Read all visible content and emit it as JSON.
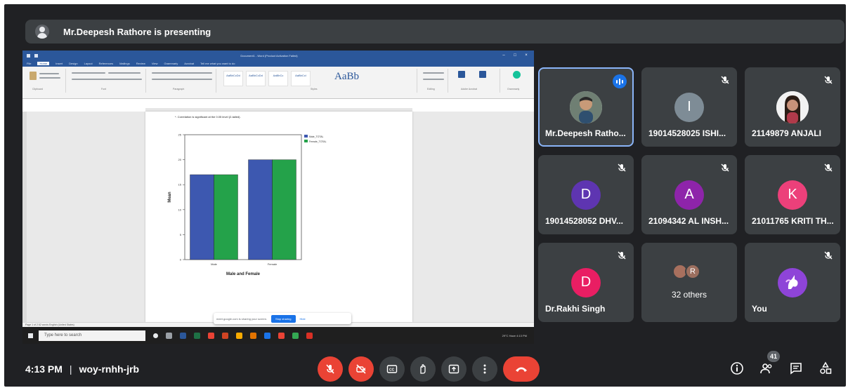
{
  "banner": {
    "text": "Mr.Deepesh Rathore is presenting"
  },
  "screen": {
    "window_title": "Document1 - Word (Product Activation Failed)",
    "menu_tabs": [
      "File",
      "Home",
      "Insert",
      "Design",
      "Layout",
      "References",
      "Mailings",
      "Review",
      "View",
      "Grammarly",
      "Acrobat",
      "Tell me what you want to do"
    ],
    "active_tab": "Home",
    "ribbon_groups": [
      "Clipboard",
      "Font",
      "Paragraph",
      "Styles",
      "Editing",
      "Adobe Acrobat",
      "Grammarly"
    ],
    "style_labels": [
      "AaBbCcDd",
      "AaBbCcDd",
      "AaBbCc",
      "AaBbCcI",
      "AaBb"
    ],
    "correlation_note": "*. Correlation is significant at the 0.05 level (2-tailed).",
    "status_text": "Page 1 of 2   62 words   English (United States)",
    "share_notice": "meet.google.com is sharing your screen.",
    "stop_sharing": "Stop sharing",
    "hide": "Hide",
    "taskbar_search": "Type here to search",
    "tray": "29°C Haze  4:13 PM"
  },
  "chart_data": {
    "type": "bar",
    "categories": [
      "Male",
      "Female"
    ],
    "series": [
      {
        "name": "Male_TOTAL",
        "values": [
          17,
          20
        ]
      },
      {
        "name": "Female_TOTAL",
        "values": [
          17,
          20
        ]
      }
    ],
    "xlabel": "Male and Female",
    "ylabel": "Mean",
    "ylim": [
      0,
      25
    ],
    "yticks": [
      0,
      5,
      10,
      15,
      20,
      25
    ],
    "colors": [
      "#3d58b0",
      "#24a24a"
    ]
  },
  "tiles": [
    {
      "name": "Mr.Deepesh Ratho...",
      "type": "photo",
      "speaking": true
    },
    {
      "name": "19014528025 ISHI...",
      "initial": "I",
      "color": "#7e8c96"
    },
    {
      "name": "21149879 ANJALI",
      "type": "photo"
    },
    {
      "name": "19014528052 DHV...",
      "initial": "D",
      "color": "#5e35b1"
    },
    {
      "name": "21094342 AL INSH...",
      "initial": "A",
      "color": "#8e24aa"
    },
    {
      "name": "21011765 KRITI TH...",
      "initial": "K",
      "color": "#ec407a"
    },
    {
      "name": "Dr.Rakhi Singh",
      "initial": "D",
      "color": "#e91e63"
    },
    {
      "name": "32 others",
      "others_initial": "R"
    },
    {
      "name": "You",
      "type": "unicorn"
    }
  ],
  "bottom": {
    "time": "4:13 PM",
    "code": "woy-rnhh-jrb",
    "participant_count": "41"
  },
  "colors": {
    "bg": "#202124",
    "tile": "#3c4043",
    "red": "#ea4335",
    "accent": "#8ab4f8"
  }
}
